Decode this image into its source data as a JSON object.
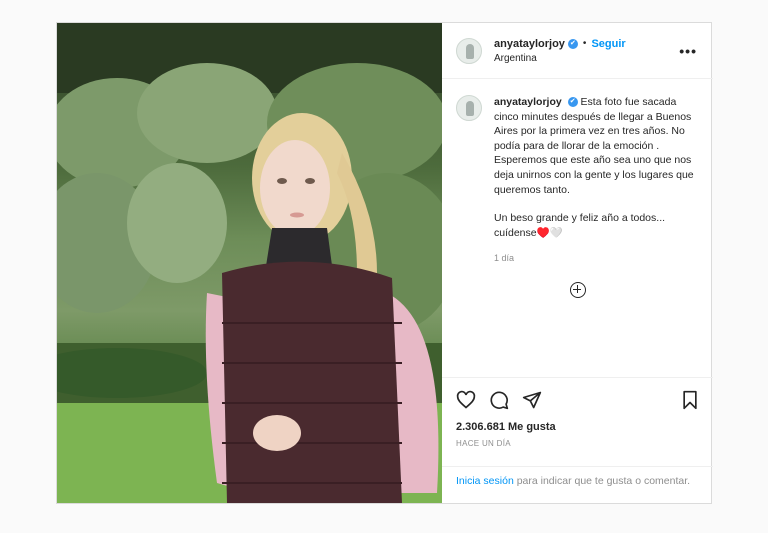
{
  "post": {
    "username": "anyataylorjoy",
    "verified_badge": "✔",
    "separator": "•",
    "follow_label": "Seguir",
    "location": "Argentina",
    "more_icon": "•••",
    "caption_user": "anyataylorjoy",
    "caption_p1": "Esta foto fue sacada cinco minutes después de llegar a Buenos Aires por la primera vez en tres años. No podía para de llorar de la emoción . Esperemos que este año sea uno que nos deja unirnos con la gente y los lugares que queremos tanto.",
    "caption_p2": "Un beso grande y feliz año a todos... cuídense♥️🤍",
    "time": "1 día",
    "likes": "2.306.681 Me gusta",
    "posted_ago": "HACE UN DÍA",
    "login_link": "Inicia sesión",
    "login_rest": " para indicar que te gusta o comentar."
  },
  "colors": {
    "link": "#0095f6",
    "verified": "#3897f0",
    "border": "#dbdbdb"
  },
  "icons": [
    "heart-icon",
    "comment-icon",
    "share-icon",
    "bookmark-icon",
    "plus-circle-icon",
    "more-icon"
  ]
}
